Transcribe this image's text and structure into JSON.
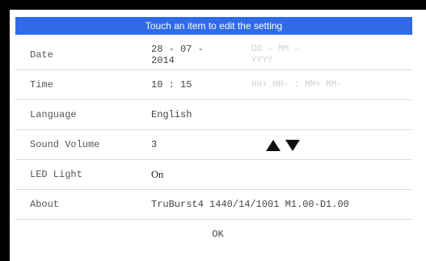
{
  "header": {
    "title": "Touch an item to edit the setting"
  },
  "settings": {
    "date": {
      "label": "Date",
      "value_line1": "28 - 07 -",
      "value_line2": "2014",
      "hint_line1": "DD - MM -",
      "hint_line2": "YYYY"
    },
    "time": {
      "label": "Time",
      "value": "10 : 15",
      "hint": "HH+ HH- : MM+ MM-"
    },
    "language": {
      "label": "Language",
      "value": "English"
    },
    "sound_volume": {
      "label": "Sound Volume",
      "value": "3",
      "up_icon": "triangle-up",
      "down_icon": "triangle-down"
    },
    "led_light": {
      "label": "LED Light",
      "value": "On"
    },
    "about": {
      "label": "About",
      "value": "TruBurst4 1440/14/1001 M1.00-D1.00"
    }
  },
  "footer": {
    "ok_label": "OK"
  },
  "colors": {
    "header_bg": "#2f6be6",
    "header_text": "#ffffff",
    "bezel": "#000000"
  }
}
